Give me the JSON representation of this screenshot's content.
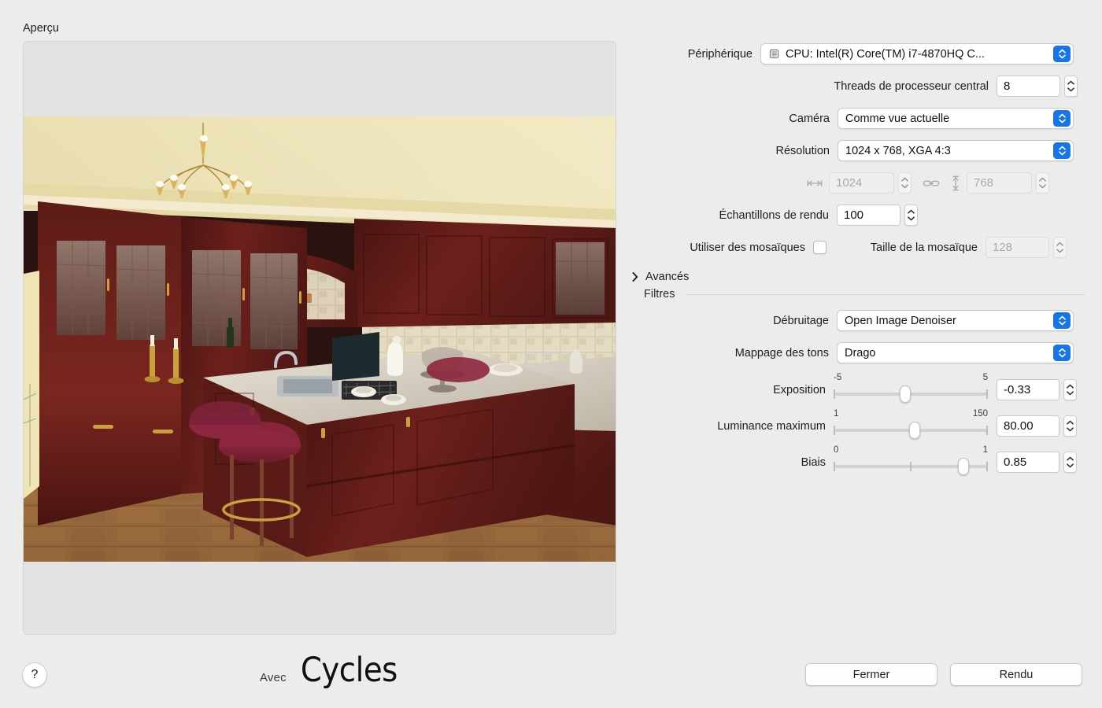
{
  "preview": {
    "label": "Aperçu",
    "image_alt": "rendered-kitchen-interior"
  },
  "branding": {
    "prefix": "Avec",
    "engine": "Cycles"
  },
  "help": {
    "glyph": "?"
  },
  "buttons": {
    "close": "Fermer",
    "render": "Rendu"
  },
  "settings": {
    "device": {
      "label": "Périphérique",
      "value": "CPU: Intel(R) Core(TM) i7-4870HQ C...",
      "icon": "cpu-icon"
    },
    "cpu_threads": {
      "label": "Threads de processeur central",
      "value": "8"
    },
    "camera": {
      "label": "Caméra",
      "value": "Comme vue actuelle"
    },
    "resolution": {
      "label": "Résolution",
      "value": "1024 x 768, XGA 4:3"
    },
    "width": {
      "value": "1024",
      "icon": "width-arrows-icon",
      "disabled": true
    },
    "link": {
      "icon": "chain-link-icon",
      "disabled": true
    },
    "height": {
      "value": "768",
      "icon": "height-arrows-icon",
      "disabled": true
    },
    "render_samples": {
      "label": "Échantillons de rendu",
      "value": "100"
    },
    "use_tiles": {
      "label": "Utiliser des mosaïques",
      "checked": false
    },
    "tile_size": {
      "label": "Taille de la mosaïque",
      "value": "128",
      "disabled": true
    },
    "advanced": {
      "label": "Avancés",
      "expanded": false
    }
  },
  "filters": {
    "title": "Filtres",
    "denoising": {
      "label": "Débruitage",
      "value": "Open Image Denoiser"
    },
    "tone_mapping": {
      "label": "Mappage des tons",
      "value": "Drago"
    },
    "exposure": {
      "label": "Exposition",
      "min": "-5",
      "max": "5",
      "value": "-0.33",
      "thumb_percent": 46.7,
      "ticks": []
    },
    "max_luminance": {
      "label": "Luminance maximum",
      "min": "1",
      "max": "150",
      "value": "80.00",
      "thumb_percent": 53,
      "ticks": []
    },
    "bias": {
      "label": "Biais",
      "min": "0",
      "max": "1",
      "value": "0.85",
      "thumb_percent": 85,
      "ticks": [
        0,
        50,
        100
      ]
    }
  },
  "colors": {
    "background": "#ececec",
    "accent_blue": "#1675e8",
    "field_white": "#ffffff",
    "disabled_grey": "#a9a9a9"
  }
}
